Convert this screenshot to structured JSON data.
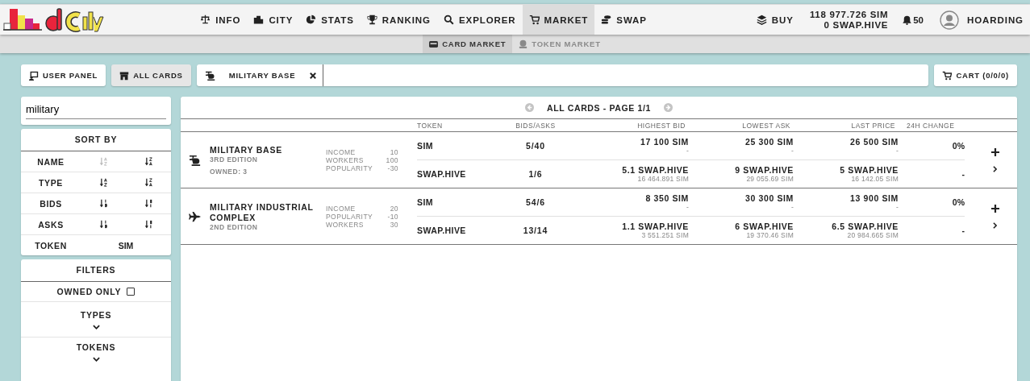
{
  "header": {
    "nav": [
      {
        "label": "INFO",
        "selected": false
      },
      {
        "label": "CITY",
        "selected": false
      },
      {
        "label": "STATS",
        "selected": false
      },
      {
        "label": "RANKING",
        "selected": false
      },
      {
        "label": "EXPLORER",
        "selected": false
      },
      {
        "label": "MARKET",
        "selected": true
      },
      {
        "label": "SWAP",
        "selected": false
      }
    ],
    "buy": "BUY",
    "balances": [
      "118 977.726 SIM",
      "0 SWAP.HIVE"
    ],
    "notifications": "50",
    "user": "HOARDING"
  },
  "subnav": [
    {
      "label": "CARD MARKET",
      "selected": true,
      "disabled": false
    },
    {
      "label": "TOKEN MARKET",
      "selected": false,
      "disabled": true
    }
  ],
  "toolbar": {
    "buttons": [
      {
        "label": "USER PANEL",
        "selected": false
      },
      {
        "label": "ALL CARDS",
        "selected": true
      }
    ],
    "chip": "MILITARY BASE",
    "cart": "CART (0/0/0)"
  },
  "search": {
    "value": "military"
  },
  "sort": {
    "title": "SORT BY",
    "rows": [
      {
        "label": "NAME",
        "kind": "alpha",
        "asc_disabled": true
      },
      {
        "label": "TYPE",
        "kind": "alpha",
        "asc_disabled": false
      },
      {
        "label": "BIDS",
        "kind": "numeric",
        "asc_disabled": false
      },
      {
        "label": "ASKS",
        "kind": "numeric",
        "asc_disabled": false
      }
    ],
    "token_label": "TOKEN",
    "token_value": "SIM"
  },
  "filters": {
    "title": "FILTERS",
    "owned_only": {
      "label": "OWNED ONLY",
      "checked": false
    },
    "sections": [
      {
        "label": "TYPES",
        "expanded": false
      },
      {
        "label": "TOKENS",
        "expanded": false
      }
    ]
  },
  "table": {
    "pager": {
      "label": "ALL CARDS - PAGE 1/1",
      "prev_disabled": true,
      "next_disabled": true
    },
    "columns": [
      "TOKEN",
      "BIDS/ASKS",
      "HIGHEST BID",
      "LOWEST ASK",
      "LAST PRICE",
      "24H CHANGE"
    ],
    "cards": [
      {
        "name": "MILITARY BASE",
        "edition": "3RD EDITION",
        "owned": "OWNED: 3",
        "stats": [
          {
            "label": "INCOME",
            "value": "10"
          },
          {
            "label": "WORKERS",
            "value": "100"
          },
          {
            "label": "POPULARITY",
            "value": "-30"
          }
        ],
        "markets": [
          {
            "token": "SIM",
            "bids_asks": "5/40",
            "highest_bid": "17 100 SIM",
            "highest_bid_sub": "-",
            "lowest_ask": "25 300 SIM",
            "lowest_ask_sub": "-",
            "last_price": "26 500 SIM",
            "last_price_sub": "-",
            "change": "0%"
          },
          {
            "token": "SWAP.HIVE",
            "bids_asks": "1/6",
            "highest_bid": "5.1 SWAP.HIVE",
            "highest_bid_sub": "16 464.891 SIM",
            "lowest_ask": "9 SWAP.HIVE",
            "lowest_ask_sub": "29 055.69 SIM",
            "last_price": "5 SWAP.HIVE",
            "last_price_sub": "16 142.05 SIM",
            "change": "-"
          }
        ]
      },
      {
        "name": "MILITARY INDUSTRIAL COMPLEX",
        "edition": "2ND EDITION",
        "stats": [
          {
            "label": "INCOME",
            "value": "20"
          },
          {
            "label": "POPULARITY",
            "value": "-10"
          },
          {
            "label": "WORKERS",
            "value": "30"
          }
        ],
        "markets": [
          {
            "token": "SIM",
            "bids_asks": "54/6",
            "highest_bid": "8 350 SIM",
            "highest_bid_sub": "-",
            "lowest_ask": "30 300 SIM",
            "lowest_ask_sub": "-",
            "last_price": "13 900 SIM",
            "last_price_sub": "-",
            "change": "0%"
          },
          {
            "token": "SWAP.HIVE",
            "bids_asks": "13/14",
            "highest_bid": "1.1 SWAP.HIVE",
            "highest_bid_sub": "3 551.251 SIM",
            "lowest_ask": "6 SWAP.HIVE",
            "lowest_ask_sub": "19 370.46 SIM",
            "last_price": "6.5 SWAP.HIVE",
            "last_price_sub": "20 984.665 SIM",
            "change": "-"
          }
        ]
      }
    ]
  }
}
